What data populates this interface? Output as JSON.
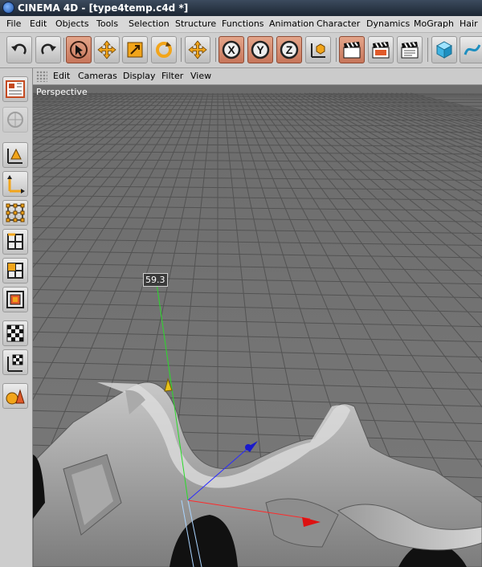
{
  "app": {
    "title": "CINEMA 4D - [type4temp.c4d *]",
    "logo_icon": "cinema4d-logo-icon"
  },
  "menubar": {
    "items": [
      "File",
      "Edit",
      "Objects",
      "Tools",
      "Selection",
      "Structure",
      "Functions",
      "Animation",
      "Character",
      "Dynamics",
      "MoGraph",
      "Hair"
    ]
  },
  "toolbar": {
    "buttons": [
      {
        "name": "undo-button",
        "icon": "undo-icon"
      },
      {
        "name": "redo-button",
        "icon": "redo-icon"
      },
      {
        "name": "live-selection-button",
        "icon": "live-selection-icon"
      },
      {
        "name": "move-button",
        "icon": "move-icon"
      },
      {
        "name": "scale-button",
        "icon": "scale-icon"
      },
      {
        "name": "rotate-button",
        "icon": "rotate-icon"
      },
      {
        "name": "recent-tool-button",
        "icon": "move-icon"
      },
      {
        "name": "x-axis-lock-button",
        "icon": "x-axis-icon",
        "label": "X"
      },
      {
        "name": "y-axis-lock-button",
        "icon": "y-axis-icon",
        "label": "Y"
      },
      {
        "name": "z-axis-lock-button",
        "icon": "z-axis-icon",
        "label": "Z"
      },
      {
        "name": "coordinate-system-button",
        "icon": "world-coordinate-icon"
      },
      {
        "name": "render-view-button",
        "icon": "clapper-icon"
      },
      {
        "name": "render-picture-viewer-button",
        "icon": "clapper-icon"
      },
      {
        "name": "render-settings-button",
        "icon": "clapper-icon"
      },
      {
        "name": "cube-primitive-button",
        "icon": "cube-icon"
      },
      {
        "name": "spline-button",
        "icon": "spline-pen-icon"
      }
    ]
  },
  "leftbar": {
    "buttons": [
      {
        "name": "use-model-mode-button",
        "icon": "model-mode-icon"
      },
      {
        "name": "use-object-mode-button",
        "icon": "object-tool-icon"
      },
      {
        "name": "use-object-axis-button",
        "icon": "object-axis-icon"
      },
      {
        "name": "use-axis-mode-button",
        "icon": "axis-mode-icon"
      },
      {
        "name": "use-points-mode-button",
        "icon": "points-mode-icon"
      },
      {
        "name": "use-edges-mode-button",
        "icon": "edges-mode-icon"
      },
      {
        "name": "use-polygons-mode-button",
        "icon": "polygons-mode-icon"
      },
      {
        "name": "use-texture-mode-button",
        "icon": "texture-mode-icon"
      },
      {
        "name": "texture-axis-button",
        "icon": "texture-axis-icon"
      },
      {
        "name": "animation-mode-button",
        "icon": "uv-grid-icon"
      },
      {
        "name": "workplane-button",
        "icon": "workplane-axis-icon"
      },
      {
        "name": "paint-mode-button",
        "icon": "sculpt-primitives-icon"
      }
    ]
  },
  "viewport": {
    "menu": [
      "Edit",
      "Cameras",
      "Display",
      "Filter",
      "View"
    ],
    "label": "Perspective",
    "readout": "59.3",
    "colors": {
      "background": "#6f6f6f",
      "grid": "#4d4d4d",
      "x_axis": "#ff2a2a",
      "y_axis": "#2adb2a",
      "z_axis": "#2a2aff"
    }
  }
}
